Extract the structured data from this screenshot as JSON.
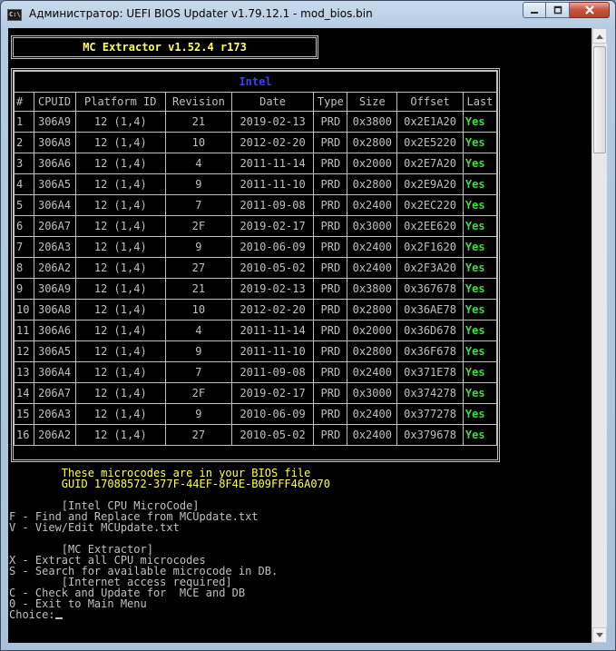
{
  "window": {
    "title": "Администратор:  UEFI BIOS Updater v1.79.12.1 - mod_bios.bin",
    "icon_glyph": "C:\\",
    "controls": {
      "minimize": "–",
      "maximize": "□",
      "close": "✕"
    }
  },
  "banner": {
    "title": "MC Extractor v1.52.4 r173"
  },
  "table": {
    "caption": "Intel",
    "headers": [
      "#",
      "CPUID",
      "Platform ID",
      "Revision",
      "Date",
      "Type",
      "Size",
      "Offset",
      "Last"
    ],
    "rows": [
      [
        "1",
        "306A9",
        "12 (1,4)",
        "21",
        "2019-02-13",
        "PRD",
        "0x3800",
        "0x2E1A20",
        "Yes"
      ],
      [
        "2",
        "306A8",
        "12 (1,4)",
        "10",
        "2012-02-20",
        "PRD",
        "0x2800",
        "0x2E5220",
        "Yes"
      ],
      [
        "3",
        "306A6",
        "12 (1,4)",
        "4",
        "2011-11-14",
        "PRD",
        "0x2000",
        "0x2E7A20",
        "Yes"
      ],
      [
        "4",
        "306A5",
        "12 (1,4)",
        "9",
        "2011-11-10",
        "PRD",
        "0x2800",
        "0x2E9A20",
        "Yes"
      ],
      [
        "5",
        "306A4",
        "12 (1,4)",
        "7",
        "2011-09-08",
        "PRD",
        "0x2400",
        "0x2EC220",
        "Yes"
      ],
      [
        "6",
        "206A7",
        "12 (1,4)",
        "2F",
        "2019-02-17",
        "PRD",
        "0x3000",
        "0x2EE620",
        "Yes"
      ],
      [
        "7",
        "206A3",
        "12 (1,4)",
        "9",
        "2010-06-09",
        "PRD",
        "0x2400",
        "0x2F1620",
        "Yes"
      ],
      [
        "8",
        "206A2",
        "12 (1,4)",
        "27",
        "2010-05-02",
        "PRD",
        "0x2400",
        "0x2F3A20",
        "Yes"
      ],
      [
        "9",
        "306A9",
        "12 (1,4)",
        "21",
        "2019-02-13",
        "PRD",
        "0x3800",
        "0x367678",
        "Yes"
      ],
      [
        "10",
        "306A8",
        "12 (1,4)",
        "10",
        "2012-02-20",
        "PRD",
        "0x2800",
        "0x36AE78",
        "Yes"
      ],
      [
        "11",
        "306A6",
        "12 (1,4)",
        "4",
        "2011-11-14",
        "PRD",
        "0x2000",
        "0x36D678",
        "Yes"
      ],
      [
        "12",
        "306A5",
        "12 (1,4)",
        "9",
        "2011-11-10",
        "PRD",
        "0x2800",
        "0x36F678",
        "Yes"
      ],
      [
        "13",
        "306A4",
        "12 (1,4)",
        "7",
        "2011-09-08",
        "PRD",
        "0x2400",
        "0x371E78",
        "Yes"
      ],
      [
        "14",
        "206A7",
        "12 (1,4)",
        "2F",
        "2019-02-17",
        "PRD",
        "0x3000",
        "0x374278",
        "Yes"
      ],
      [
        "15",
        "206A3",
        "12 (1,4)",
        "9",
        "2010-06-09",
        "PRD",
        "0x2400",
        "0x377278",
        "Yes"
      ],
      [
        "16",
        "206A2",
        "12 (1,4)",
        "27",
        "2010-05-02",
        "PRD",
        "0x2400",
        "0x379678",
        "Yes"
      ]
    ]
  },
  "console": {
    "bios_note": "These microcodes are in your BIOS file",
    "guid": "GUID 17088572-377F-44EF-8F4E-B09FFF46A070",
    "intel_section": "[Intel CPU MicroCode]",
    "opt_f": "F - Find and Replace from MCUpdate.txt",
    "opt_v": "V - View/Edit MCUpdate.txt",
    "mc_section": "[MC Extractor]",
    "opt_x": "X - Extract all CPU microcodes",
    "opt_s": "S - Search for available microcode in DB.",
    "internet_note": "[Internet access required]",
    "opt_c": "C - Check and Update for  MCE and DB",
    "opt_0": "0 - Exit to Main Menu",
    "prompt": "Choice:"
  },
  "colors": {
    "console_bg": "#000000",
    "console_text": "#c0c0c0",
    "yellow": "#ffff55",
    "intel_blue": "#3f3fff",
    "yes_green": "#3fdc3f"
  }
}
